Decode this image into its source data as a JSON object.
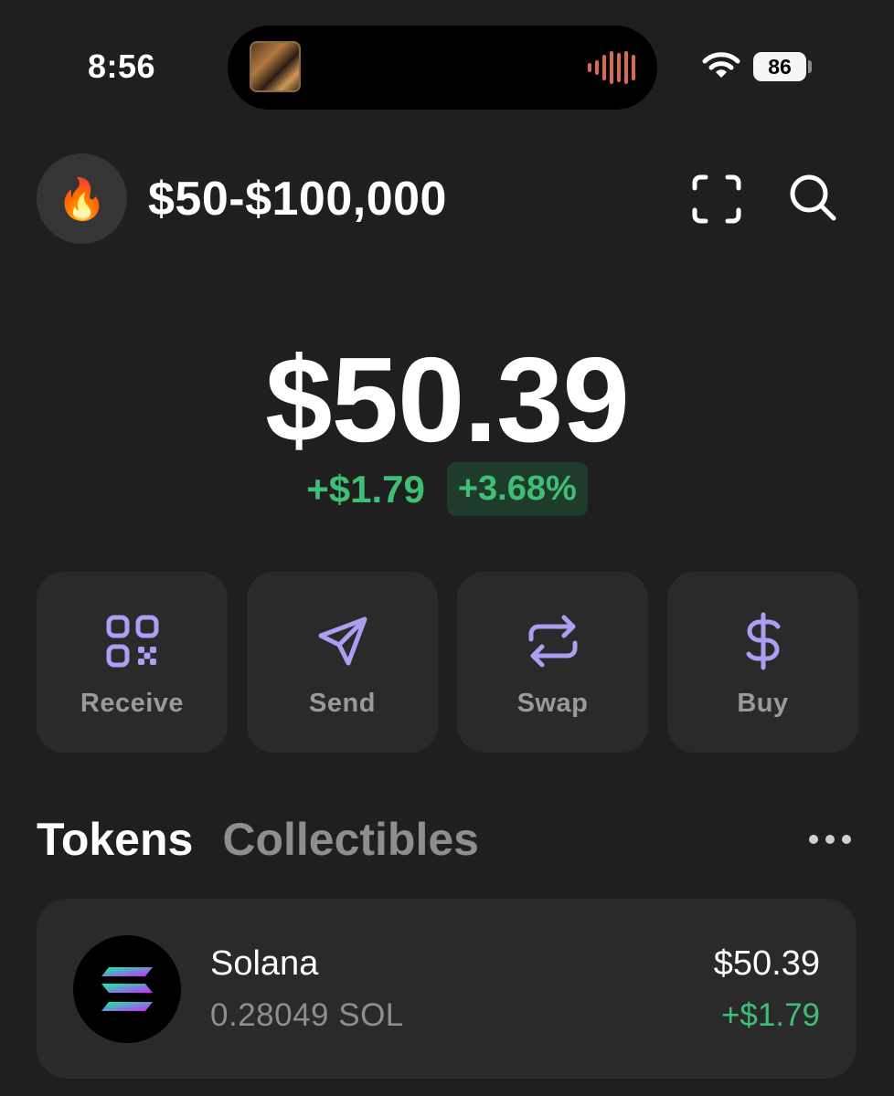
{
  "status_bar": {
    "time": "8:56",
    "battery": "86",
    "icons": [
      "now-playing-art-icon",
      "audio-waveform-icon",
      "wifi-icon",
      "battery-icon"
    ]
  },
  "header": {
    "avatar_emoji": "🔥",
    "account_name": "$50-$100,000",
    "icons": [
      "scan-icon",
      "search-icon"
    ]
  },
  "balance": {
    "total": "$50.39",
    "change_abs": "+$1.79",
    "change_pct": "+3.68%"
  },
  "actions": [
    {
      "label": "Receive",
      "icon": "qr-code-icon"
    },
    {
      "label": "Send",
      "icon": "send-icon"
    },
    {
      "label": "Swap",
      "icon": "swap-icon"
    },
    {
      "label": "Buy",
      "icon": "dollar-icon"
    }
  ],
  "tabs": [
    {
      "label": "Tokens",
      "active": true
    },
    {
      "label": "Collectibles",
      "active": false
    }
  ],
  "tokens": [
    {
      "name": "Solana",
      "amount": "0.28049 SOL",
      "value": "$50.39",
      "change": "+$1.79",
      "icon": "solana-logo-icon"
    }
  ],
  "colors": {
    "background": "#1f1f1f",
    "card": "#2a2a2a",
    "accent_purple": "#ab9ff2",
    "positive_green": "#3fbf75",
    "muted_text": "#8e8e8e"
  }
}
